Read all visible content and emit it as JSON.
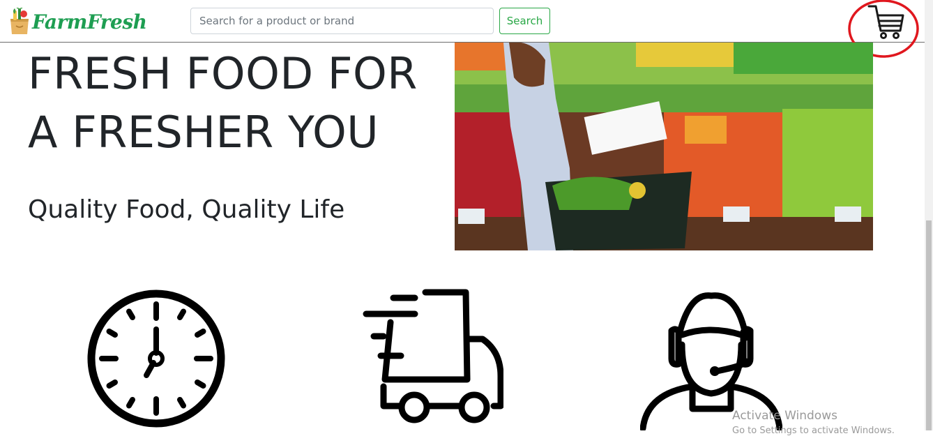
{
  "navbar": {
    "brand": "FarmFresh",
    "search_placeholder": "Search for a product or brand",
    "search_value": "",
    "search_button": "Search",
    "cart_icon": "shopping-cart-icon"
  },
  "hero": {
    "title": "FRESH FOOD FOR A FRESHER YOU",
    "subtitle": "Quality Food, Quality Life",
    "image": "woman-shopping-produce-photo"
  },
  "features": {
    "icons": [
      "clock-icon",
      "delivery-truck-icon",
      "customer-support-icon"
    ]
  },
  "watermark": {
    "title": "Activate Windows",
    "subtitle": "Go to Settings to activate Windows."
  },
  "colors": {
    "brand_green": "#1e9e52",
    "button_green": "#28a745",
    "annotation_red": "#e0171e",
    "text": "#212529"
  }
}
